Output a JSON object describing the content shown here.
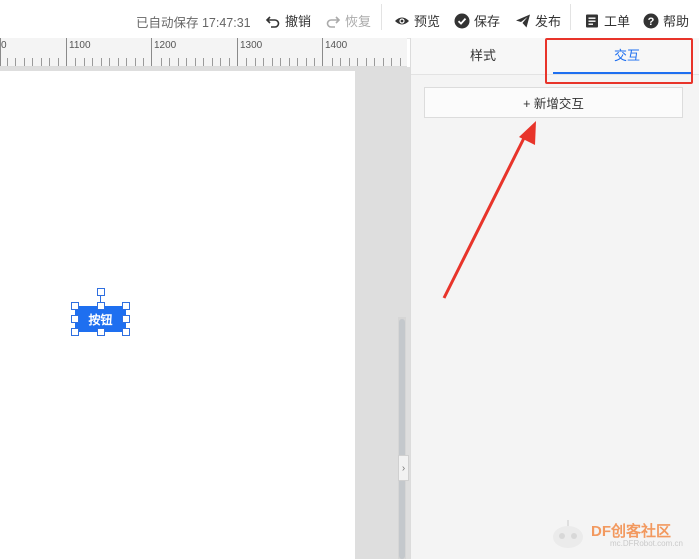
{
  "toolbar": {
    "autosave_text": "已自动保存 17:47:31",
    "undo_label": "撤销",
    "redo_label": "恢复",
    "preview_label": "预览",
    "save_label": "保存",
    "publish_label": "发布",
    "ticket_label": "工单",
    "help_label": "帮助"
  },
  "ruler": {
    "labels": [
      "0",
      "1100",
      "1200",
      "1300",
      "1400"
    ]
  },
  "canvas": {
    "widget_label": "按钮",
    "collapse_glyph": "›",
    "accent_color": "#1e6ff0"
  },
  "panel": {
    "tab_style": "样式",
    "tab_interaction": "交互",
    "active_tab": "交互",
    "add_interaction_label": "+ 新增交互"
  },
  "annotation": {
    "highlight_color": "#e8342a"
  },
  "watermark": {
    "brand": "DF创客社区",
    "sub": "mc.DFRobot.com.cn"
  },
  "icons": [
    "undo-icon",
    "redo-icon",
    "eye-icon",
    "check-circle-icon",
    "paper-plane-icon",
    "ticket-icon",
    "help-icon"
  ]
}
